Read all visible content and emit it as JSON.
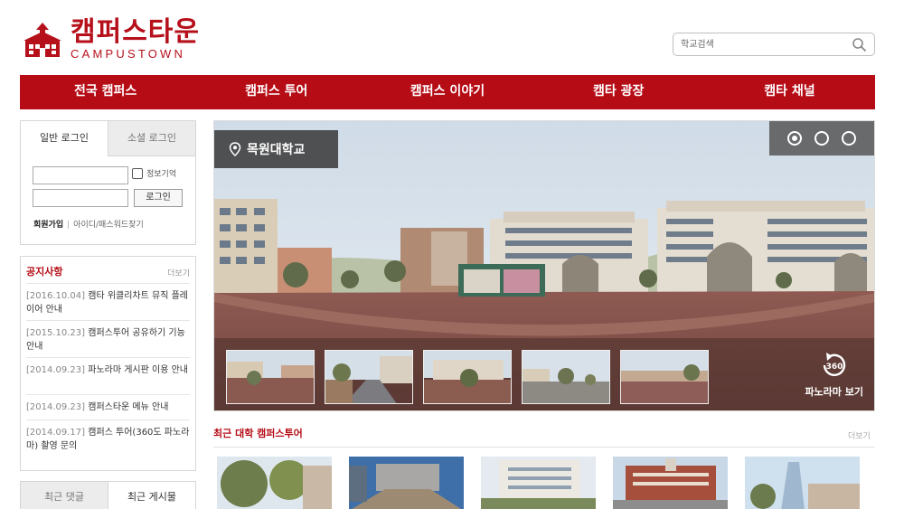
{
  "header": {
    "logo_korean": "캠퍼스타운",
    "logo_english": "CAMPUSTOWN",
    "search_placeholder": "학교검색"
  },
  "nav": {
    "items": [
      "전국 캠퍼스",
      "캠퍼스 투어",
      "캠퍼스 이야기",
      "캠타 광장",
      "캠타 채널"
    ]
  },
  "login": {
    "tab_general": "일반 로그인",
    "tab_social": "소셜 로그인",
    "remember_label": "정보기억",
    "login_button": "로그인",
    "join_link": "회원가입",
    "separator": "|",
    "find_link": "아이디/패스워드찾기"
  },
  "notice": {
    "title": "공지사항",
    "more": "더보기",
    "items": [
      {
        "date": "[2016.10.04]",
        "text": "캠타 위클리차트 뮤직 플레이어 안내"
      },
      {
        "date": "[2015.10.23]",
        "text": "캠퍼스투어 공유하기 기능 안내"
      },
      {
        "date": "[2014.09.23]",
        "text": "파노라마 게시판 이용 안내"
      },
      {
        "date": "[2014.09.23]",
        "text": "캠퍼스타운 메뉴 안내"
      },
      {
        "date": "[2014.09.17]",
        "text": "캠퍼스 투어(360도 파노라마) 촬영 문의"
      }
    ]
  },
  "bottom_tabs": {
    "comments": "최근 댓글",
    "posts": "최근 게시물"
  },
  "panorama": {
    "school_name": "목원대학교",
    "view_badge": "360",
    "view_label": "파노라마 보기"
  },
  "recent": {
    "title": "최근 대학 캠퍼스투어",
    "more": "더보기"
  },
  "colors": {
    "brand_red": "#b60c16"
  }
}
